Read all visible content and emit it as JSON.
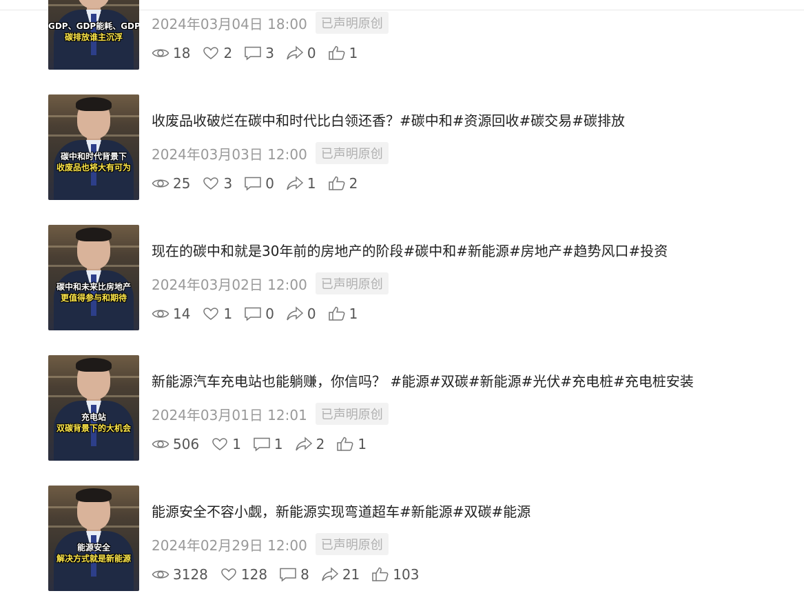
{
  "badge_label": "已声明原创",
  "icons": {
    "views": "eye-icon",
    "likes": "heart-icon",
    "comments": "comment-icon",
    "shares": "share-icon",
    "thumbs": "thumbs-up-icon"
  },
  "items": [
    {
      "caption_line1": "GDP、GDP能耗、GDP",
      "caption_line2": "碳排放谁主沉浮",
      "title": "",
      "date": "2024年03月04日 18:00",
      "views": "18",
      "likes": "2",
      "comments": "3",
      "shares": "0",
      "thumbs": "1"
    },
    {
      "caption_line1": "碳中和时代背景下",
      "caption_line2": "收废品也将大有可为",
      "title": "收废品收破烂在碳中和时代比白领还香？#碳中和#资源回收#碳交易#碳排放",
      "date": "2024年03月03日 12:00",
      "views": "25",
      "likes": "3",
      "comments": "0",
      "shares": "1",
      "thumbs": "2"
    },
    {
      "caption_line1": "碳中和未来比房地产",
      "caption_line2": "更值得参与和期待",
      "title": "现在的碳中和就是30年前的房地产的阶段#碳中和#新能源#房地产#趋势风口#投资",
      "date": "2024年03月02日 12:00",
      "views": "14",
      "likes": "1",
      "comments": "0",
      "shares": "0",
      "thumbs": "1"
    },
    {
      "caption_line1": "充电站",
      "caption_line2": "双碳背景下的大机会",
      "title": "新能源汽车充电站也能躺赚，你信吗？ #能源#双碳#新能源#光伏#充电桩#充电桩安装",
      "date": "2024年03月01日 12:01",
      "views": "506",
      "likes": "1",
      "comments": "1",
      "shares": "2",
      "thumbs": "1"
    },
    {
      "caption_line1": "能源安全",
      "caption_line2": "解决方式就是新能源",
      "title": "能源安全不容小觑，新能源实现弯道超车#新能源#双碳#能源",
      "date": "2024年02月29日 12:00",
      "views": "3128",
      "likes": "128",
      "comments": "8",
      "shares": "21",
      "thumbs": "103"
    }
  ]
}
